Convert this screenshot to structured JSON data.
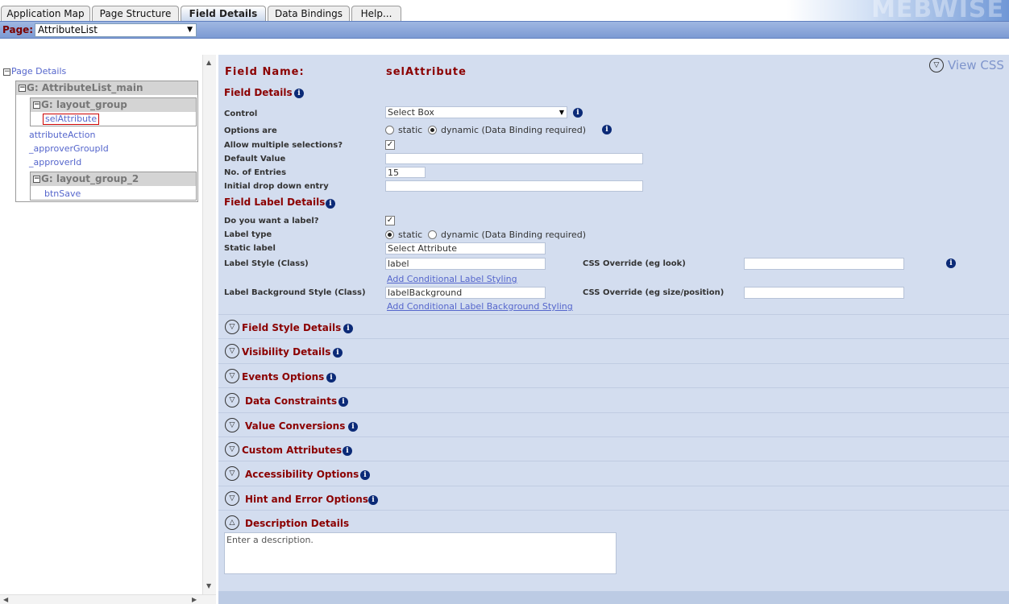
{
  "tabs": [
    {
      "label": "Application Map",
      "active": false
    },
    {
      "label": "Page Structure",
      "active": false
    },
    {
      "label": "Field Details",
      "active": true
    },
    {
      "label": "Data Bindings",
      "active": false
    },
    {
      "label": "Help...",
      "active": false
    }
  ],
  "brand": "MEBWISE",
  "page_bar": {
    "label": "Page:",
    "selected": "AttributeList"
  },
  "tree": {
    "root": "Page Details",
    "main_group": "G: AttributeList_main",
    "layout_group": "G: layout_group",
    "selected_node": "selAttribute",
    "items": [
      "attributeAction",
      "_approverGroupId",
      "_approverId"
    ],
    "layout_group_2": "G: layout_group_2",
    "btn_node": "btnSave"
  },
  "details": {
    "view_css": "View CSS",
    "field_name_label": "Field Name:",
    "field_name_value": "selAttribute",
    "field_details_title": "Field Details",
    "control_label": "Control",
    "control_value": "Select Box",
    "options_are_label": "Options are",
    "opt_static": "static",
    "opt_dynamic": "dynamic (Data Binding required)",
    "allow_multiple_label": "Allow multiple selections?",
    "default_value_label": "Default Value",
    "default_value": "",
    "entries_label": "No. of Entries",
    "entries_value": "15",
    "initial_dropdown_label": "Initial drop down entry",
    "initial_dropdown_value": "",
    "label_details_title": "Field Label Details",
    "want_label": "Do you want a label?",
    "label_type_label": "Label type",
    "label_type_static": "static",
    "label_type_dynamic": "dynamic (Data Binding required)",
    "static_label_label": "Static label",
    "static_label_value": "Select Attribute",
    "label_style_label": "Label Style (Class)",
    "label_style_value": "label",
    "css_override_look_label": "CSS Override (eg look)",
    "css_override_look_value": "",
    "add_conditional_label": "Add Conditional Label Styling",
    "label_bg_label": "Label Background Style (Class)",
    "label_bg_value": "labelBackground",
    "css_override_size_label": "CSS Override (eg size/position)",
    "css_override_size_value": "",
    "add_conditional_bg": "Add Conditional Label Background Styling"
  },
  "sections": [
    "Field Style Details",
    "Visibility Details",
    "Events Options",
    "Data Constraints",
    "Value Conversions",
    "Custom Attributes",
    "Accessibility Options",
    "Hint and Error Options",
    "Description Details"
  ],
  "description_placeholder": "Enter a description."
}
